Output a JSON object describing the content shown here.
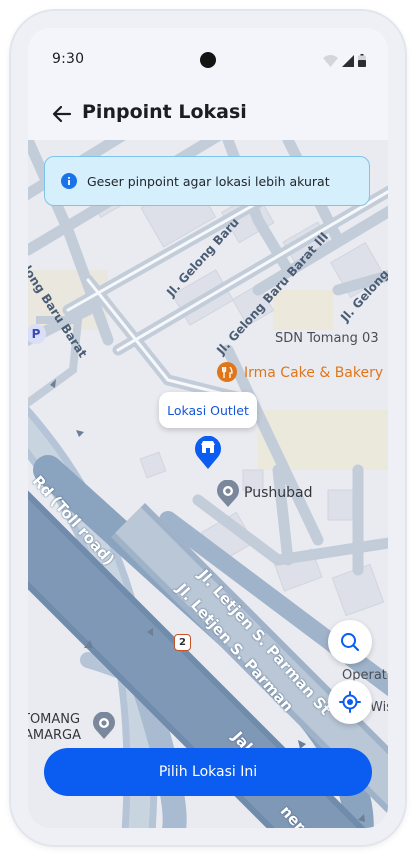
{
  "status_bar": {
    "time": "9:30"
  },
  "app_bar": {
    "title": "Pinpoint Lokasi"
  },
  "banner": {
    "text": "Geser pinpoint agar lokasi lebih akurat"
  },
  "map": {
    "labels": {
      "gelong_baru_barat": "Gelong Baru Barat",
      "jl_gelong_baru_1": "Jl. Gelong Baru",
      "jl_gelong_baru_barat_3": "Jl. Gelong Baru Barat III",
      "jl_gelong_2": "Jl. Gelong",
      "sdn": "SDN Tomang 03",
      "irma": "Irma Cake & Bakery",
      "pushubad": "Pushubad",
      "toll": "Rd (Toll road)",
      "parman1": "Jl. Letjen S. Parman St",
      "parman2": "Jl. Letjen S. Parman",
      "jalan": "Jalan",
      "ner": "ner",
      "tomang1": "TOMANG",
      "tomang2": "AMARGA",
      "operat": "Operat",
      "wis": "Wis",
      "parking": "P",
      "route_shield": "2"
    }
  },
  "tooltip": {
    "label": "Lokasi Outlet"
  },
  "cta": {
    "label": "Pilih Lokasi Ini"
  },
  "colors": {
    "primary": "#0b5cf0",
    "banner_bg": "#d6effd",
    "banner_border": "#7ec4ea",
    "poi_orange": "#e0761a",
    "highway": "#7b97b5"
  },
  "icons": {
    "back": "arrow-left-icon",
    "info": "info-icon",
    "search": "search-icon",
    "location": "my-location-icon",
    "store": "store-pin-icon",
    "food": "fork-knife-icon",
    "place": "place-marker-icon"
  }
}
